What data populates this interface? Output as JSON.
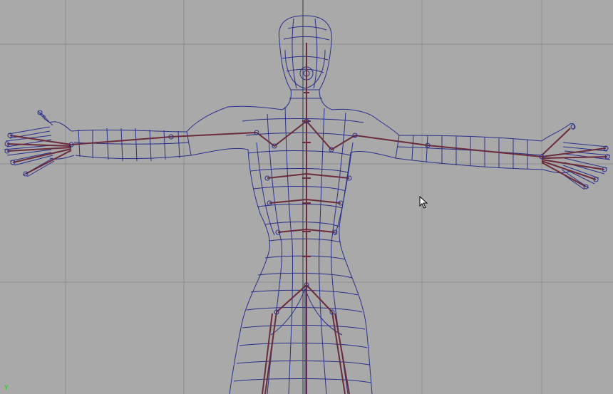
{
  "viewport": {
    "background": "#a9a9a9",
    "grid_color": "#8e8e8e",
    "axis_color": "#3a3a3a",
    "view_axis_label": "Y",
    "view_axis_color": "#00e000"
  },
  "model": {
    "wireframe_color": "#2a2f8a",
    "bone_color": "#6a2c3a",
    "pose": "T-pose",
    "display_mode": "wireframe"
  },
  "cursor": {
    "icon": "arrow-pointer-icon"
  }
}
